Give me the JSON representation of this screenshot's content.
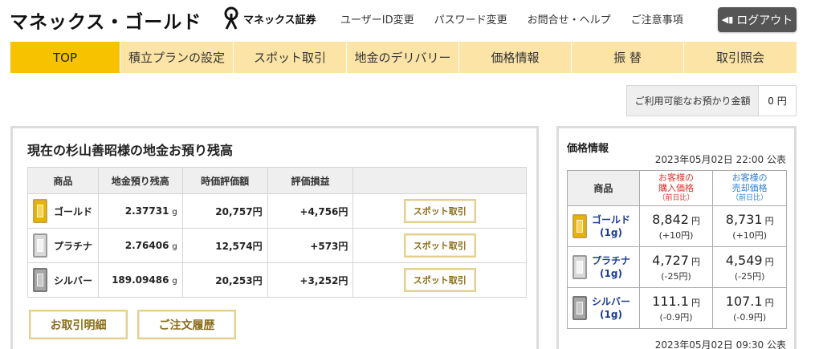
{
  "header": {
    "title": "マネックス・ゴールド",
    "logo_text": "マネックス証券",
    "links": [
      "ユーザーID変更",
      "パスワード変更",
      "お問合せ・ヘルプ",
      "ご注意事項"
    ],
    "logout_label": "ログアウト"
  },
  "nav": {
    "items": [
      "TOP",
      "積立プランの設定",
      "スポット取引",
      "地金のデリバリー",
      "価格情報",
      "振 替",
      "取引照会"
    ]
  },
  "balance": {
    "label": "ご利用可能なお預かり金額",
    "value": "0 円"
  },
  "holdings": {
    "title": "現在の杉山善昭様の地金お預り残高",
    "headers": [
      "商品",
      "地金預り残高",
      "時価評価額",
      "評価損益"
    ],
    "rows": [
      {
        "name": "ゴールド",
        "qty": "2.37731",
        "unit": "g",
        "value": "20,757円",
        "pl": "+4,756円",
        "action": "スポット取引"
      },
      {
        "name": "プラチナ",
        "qty": "2.76406",
        "unit": "g",
        "value": "12,574円",
        "pl": "+573円",
        "action": "スポット取引"
      },
      {
        "name": "シルバー",
        "qty": "189.09486",
        "unit": "g",
        "value": "20,253円",
        "pl": "+3,252円",
        "action": "スポット取引"
      }
    ],
    "btn_history": "お取引明細",
    "btn_orders": "ご注文履歴"
  },
  "prices": {
    "title": "価格情報",
    "date_top": "2023年05月02日 22:00 公表",
    "date_bottom": "2023年05月02日 09:30 公表",
    "header_name": "商品",
    "header_buy_1": "お客様の",
    "header_buy_2": "購入価格",
    "header_buy_sub": "（前日比）",
    "header_sell_1": "お客様の",
    "header_sell_2": "売却価格",
    "header_sell_sub": "（前日比）",
    "rows": [
      {
        "name": "ゴールド",
        "unit": "(1g)",
        "buy": "8,842",
        "buy_chg": "(+10円)",
        "sell": "8,731",
        "sell_chg": "(+10円)",
        "yen": "円"
      },
      {
        "name": "プラチナ",
        "unit": "(1g)",
        "buy": "4,727",
        "buy_chg": "(-25円)",
        "sell": "4,549",
        "sell_chg": "(-25円)",
        "yen": "円"
      },
      {
        "name": "シルバー",
        "unit": "(1g)",
        "buy": "111.1",
        "buy_chg": "(-0.9円)",
        "sell": "107.1",
        "sell_chg": "(-0.9円)",
        "yen": "円"
      }
    ]
  },
  "colors": {
    "nav_active": "#f7c300",
    "nav_bg": "#fbe4a6",
    "buy_header": "#e3312a",
    "sell_header": "#2d7fd1",
    "product_name": "#1c3d8f"
  }
}
